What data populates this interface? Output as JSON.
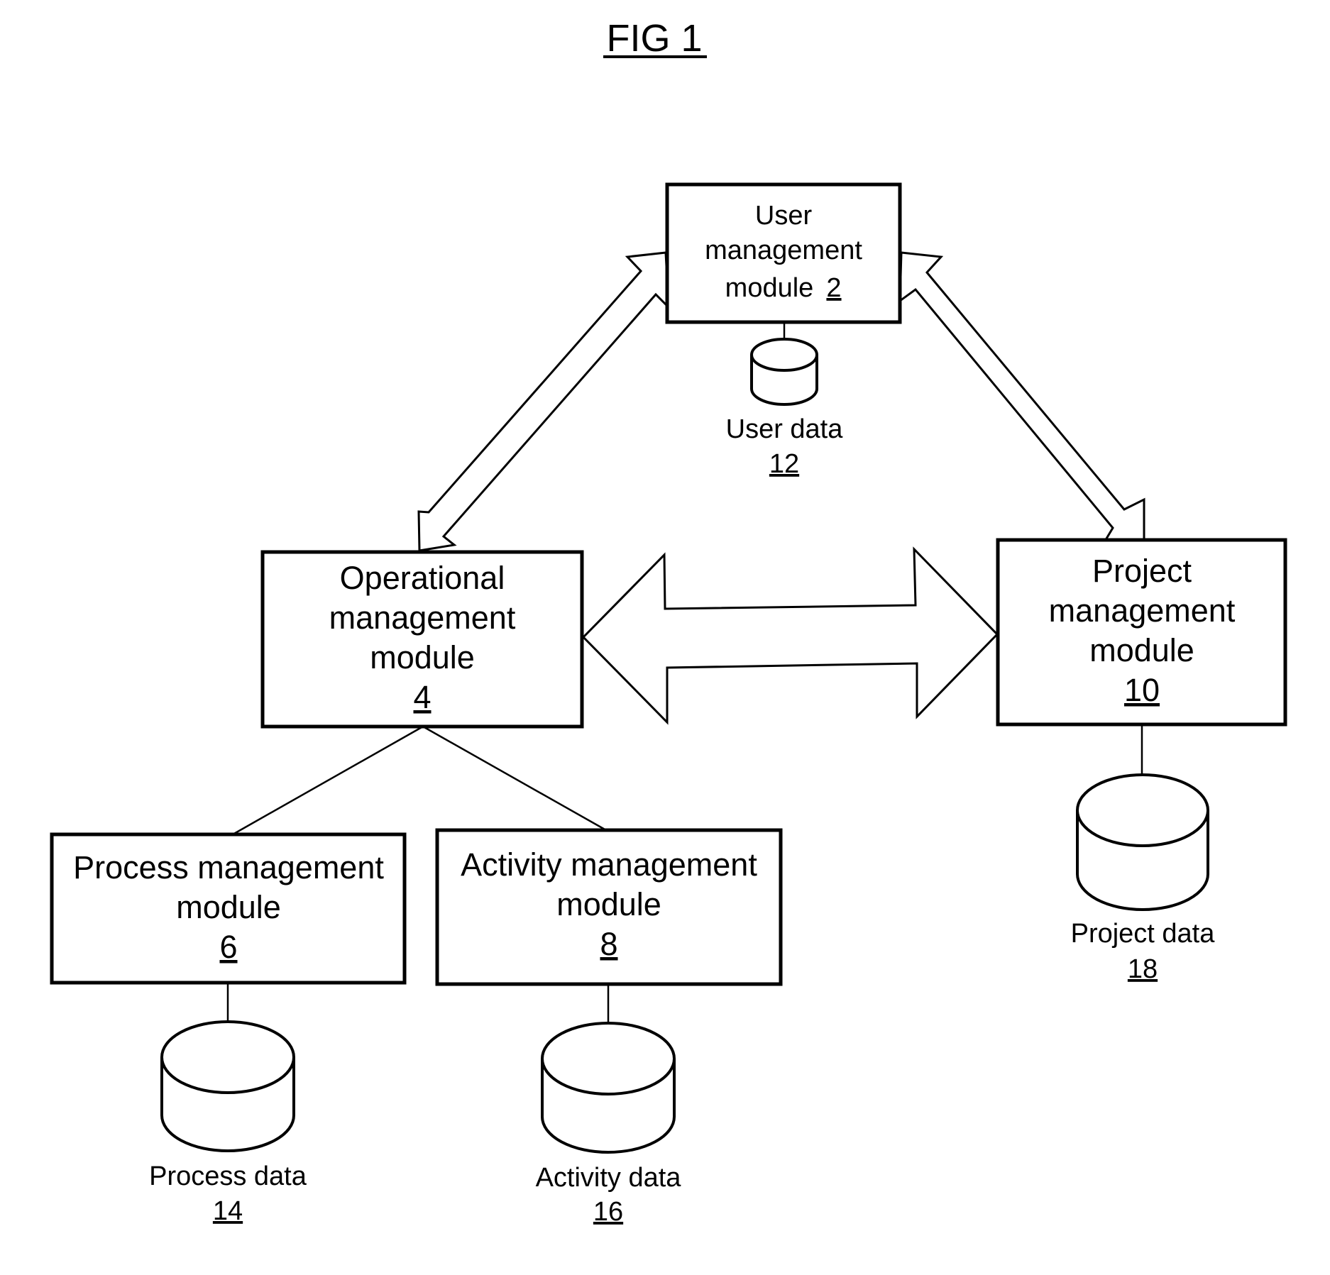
{
  "title": "FIG 1",
  "modules": {
    "user": {
      "lines": [
        "User",
        "management",
        "module"
      ],
      "ref": "2"
    },
    "operational": {
      "lines": [
        "Operational",
        "management",
        "module"
      ],
      "ref": "4"
    },
    "project": {
      "lines": [
        "Project",
        "management",
        "module"
      ],
      "ref": "10"
    },
    "process": {
      "lines": [
        "Process management",
        "module"
      ],
      "ref": "6"
    },
    "activity": {
      "lines": [
        "Activity management",
        "module"
      ],
      "ref": "8"
    }
  },
  "stores": {
    "user": {
      "label": "User data",
      "ref": "12"
    },
    "project": {
      "label": "Project data",
      "ref": "18"
    },
    "process": {
      "label": "Process data",
      "ref": "14"
    },
    "activity": {
      "label": "Activity data",
      "ref": "16"
    }
  },
  "connections": [
    {
      "from": "user",
      "to": "operational",
      "type": "bidirectional-arrow"
    },
    {
      "from": "user",
      "to": "project",
      "type": "bidirectional-arrow"
    },
    {
      "from": "operational",
      "to": "project",
      "type": "bidirectional-arrow"
    },
    {
      "from": "operational",
      "to": "process",
      "type": "line"
    },
    {
      "from": "operational",
      "to": "activity",
      "type": "line"
    },
    {
      "from": "user",
      "to": "user-data",
      "type": "line"
    },
    {
      "from": "project",
      "to": "project-data",
      "type": "line"
    },
    {
      "from": "process",
      "to": "process-data",
      "type": "line"
    },
    {
      "from": "activity",
      "to": "activity-data",
      "type": "line"
    }
  ]
}
